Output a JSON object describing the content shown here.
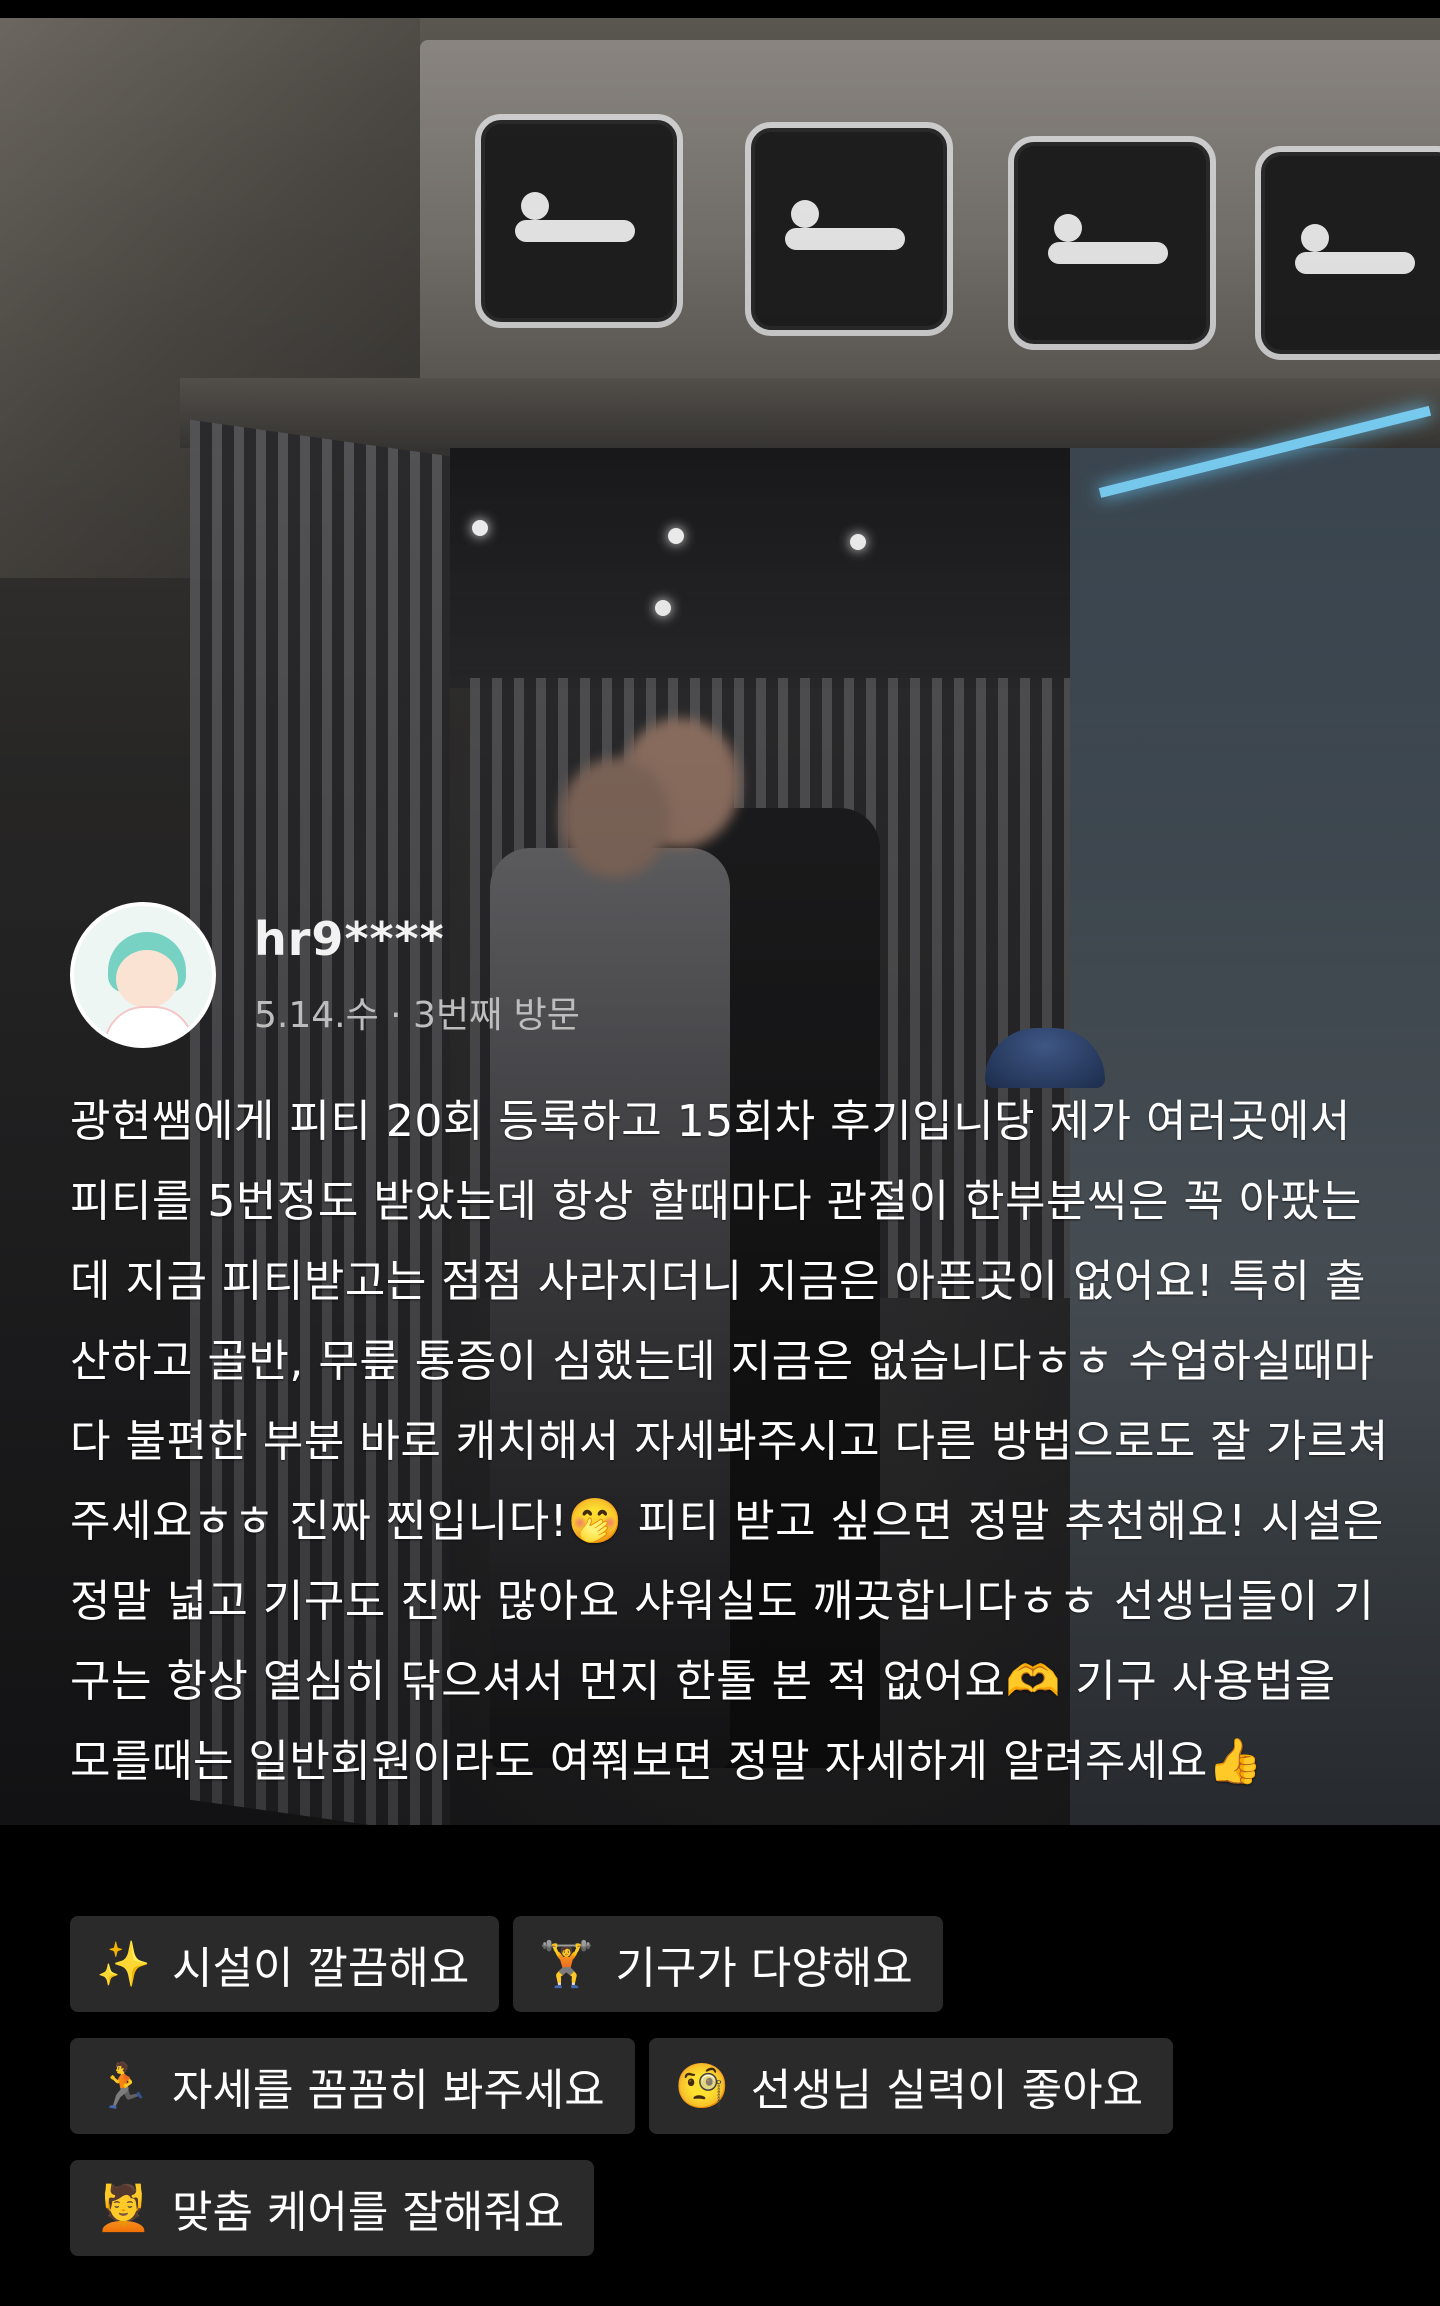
{
  "review": {
    "user_name": "hr9****",
    "visit_meta": "5.14.수 · 3번째 방문",
    "body": "광현쌤에게 피티 20회 등록하고 15회차 후기입니당 제가 여러곳에서 피티를 5번정도 받았는데 항상 할때마다 관절이 한부분씩은 꼭 아팠는데 지금 피티받고는 점점 사라지더니 지금은 아픈곳이 없어요! 특히 출산하고 골반, 무릎 통증이 심했는데 지금은 없습니다ㅎㅎ 수업하실때마다 불편한 부분 바로 캐치해서 자세봐주시고 다른 방법으로도 잘 가르쳐주세요ㅎㅎ 진짜 찐입니다!🤭 피티 받고 싶으면 정말 추천해요! 시설은 정말 넓고 기구도 진짜 많아요 샤워실도 깨끗합니다ㅎㅎ 선생님들이 기구는 항상 열심히 닦으셔서 먼지 한톨 본 적 없어요🫶 기구 사용법을 모를때는 일반회원이라도 여쭤보면 정말 자세하게 알려주세요👍"
  },
  "tags": [
    {
      "icon": "sparkles-icon",
      "emoji": "✨",
      "label": "시설이 깔끔해요"
    },
    {
      "icon": "dumbbell-icon",
      "emoji": "🏋",
      "label": "기구가 다양해요"
    },
    {
      "icon": "lunge-person-icon",
      "emoji": "🏃",
      "label": "자세를 꼼꼼히 봐주세요"
    },
    {
      "icon": "monocle-face-icon",
      "emoji": "🧐",
      "label": "선생님 실력이 좋아요"
    },
    {
      "icon": "person-care-icon",
      "emoji": "💆",
      "label": "맞춤 케어를 잘해줘요"
    }
  ]
}
